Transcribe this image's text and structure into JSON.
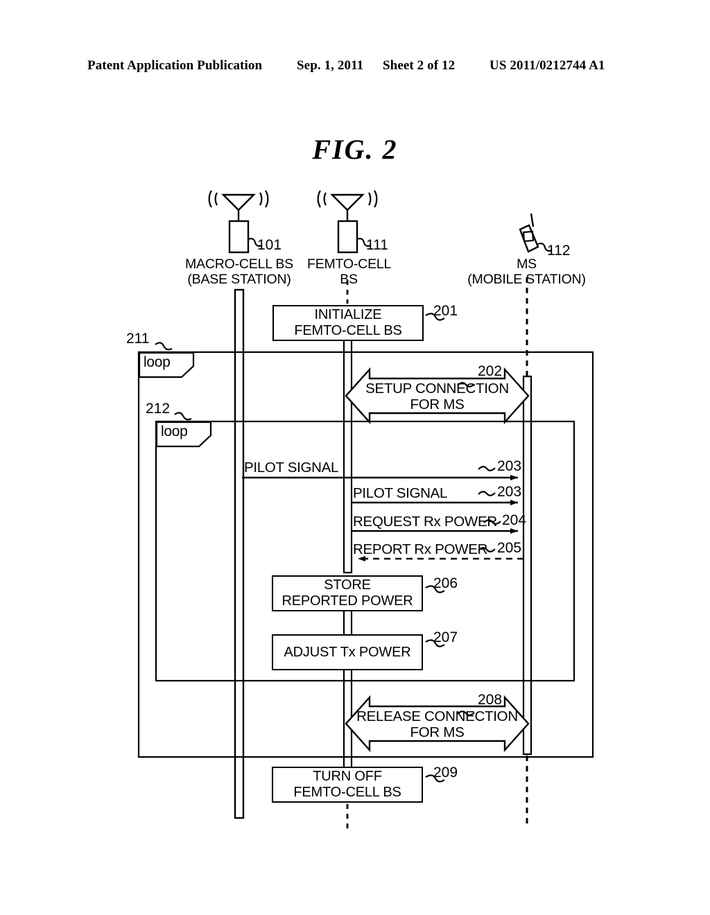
{
  "header": {
    "publication": "Patent Application Publication",
    "date": "Sep. 1, 2011",
    "sheet": "Sheet 2 of 12",
    "patent_number": "US 2011/0212744 A1"
  },
  "figure": {
    "title": "FIG.  2"
  },
  "actors": [
    {
      "id": "macro-cell-bs",
      "icon": "antenna-tower-icon",
      "ref": "101",
      "label_line1": "MACRO-CELL BS",
      "label_line2": "(BASE STATION)"
    },
    {
      "id": "femto-cell-bs",
      "icon": "antenna-tower-icon",
      "ref": "111",
      "label_line1": "FEMTO-CELL",
      "label_line2": "BS"
    },
    {
      "id": "mobile-station",
      "icon": "mobile-phone-icon",
      "ref": "112",
      "label_line1": "MS",
      "label_line2": "(MOBILE STATION)"
    }
  ],
  "frames": [
    {
      "id": "outer-loop",
      "ref": "211",
      "label": "loop"
    },
    {
      "id": "inner-loop",
      "ref": "212",
      "label": "loop"
    }
  ],
  "steps": [
    {
      "ref": "201",
      "kind": "process",
      "line1": "INITIALIZE",
      "line2": "FEMTO-CELL BS",
      "actor": "femto-cell-bs"
    },
    {
      "ref": "202",
      "kind": "bidirectional-message",
      "line1": "SETUP CONNECTION",
      "line2": "FOR MS",
      "from": "femto-cell-bs",
      "to": "mobile-station"
    },
    {
      "ref": "203",
      "kind": "message",
      "line1": "PILOT SIGNAL",
      "from": "macro-cell-bs",
      "to": "mobile-station",
      "style": "solid"
    },
    {
      "ref": "203",
      "kind": "message",
      "line1": "PILOT SIGNAL",
      "from": "femto-cell-bs",
      "to": "mobile-station",
      "style": "solid"
    },
    {
      "ref": "204",
      "kind": "message",
      "line1": "REQUEST Rx POWER",
      "from": "femto-cell-bs",
      "to": "mobile-station",
      "style": "solid"
    },
    {
      "ref": "205",
      "kind": "message",
      "line1": "REPORT Rx POWER",
      "from": "mobile-station",
      "to": "femto-cell-bs",
      "style": "dashed"
    },
    {
      "ref": "206",
      "kind": "process",
      "line1": "STORE",
      "line2": "REPORTED POWER",
      "actor": "femto-cell-bs"
    },
    {
      "ref": "207",
      "kind": "process",
      "line1": "ADJUST Tx POWER",
      "line2": "",
      "actor": "femto-cell-bs"
    },
    {
      "ref": "208",
      "kind": "bidirectional-message",
      "line1": "RELEASE CONNECTION",
      "line2": "FOR MS",
      "from": "femto-cell-bs",
      "to": "mobile-station"
    },
    {
      "ref": "209",
      "kind": "process",
      "line1": "TURN OFF",
      "line2": "FEMTO-CELL BS",
      "actor": "femto-cell-bs"
    }
  ],
  "colors": {
    "ink": "#000000",
    "paper": "#ffffff"
  }
}
